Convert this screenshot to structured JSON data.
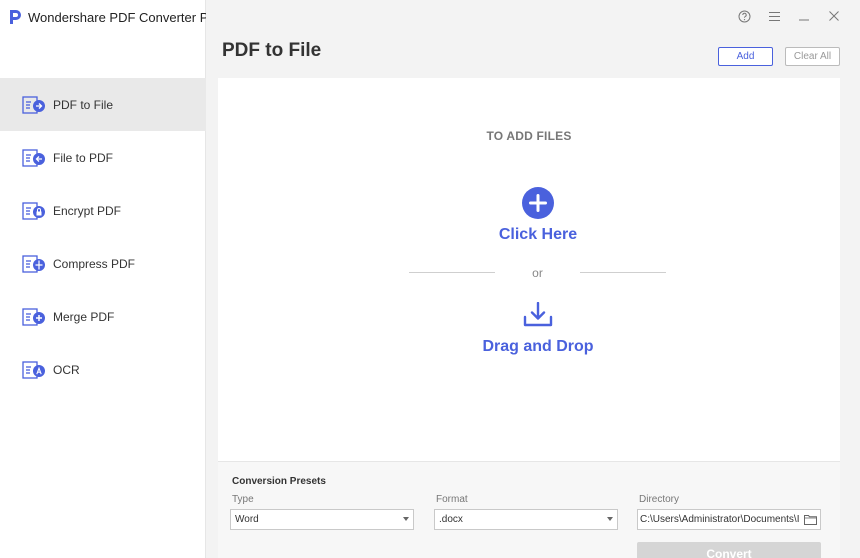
{
  "app": {
    "name": "Wondershare PDF Converter Pro ."
  },
  "sidebar": {
    "items": [
      {
        "label": "PDF to File",
        "icon": "pdf-to-file-icon",
        "active": true
      },
      {
        "label": "File to PDF",
        "icon": "file-to-pdf-icon",
        "active": false
      },
      {
        "label": "Encrypt PDF",
        "icon": "encrypt-pdf-icon",
        "active": false
      },
      {
        "label": "Compress PDF",
        "icon": "compress-pdf-icon",
        "active": false
      },
      {
        "label": "Merge PDF",
        "icon": "merge-pdf-icon",
        "active": false
      },
      {
        "label": "OCR",
        "icon": "ocr-icon",
        "active": false
      }
    ]
  },
  "header": {
    "title": "PDF to File",
    "add_label": "Add",
    "clear_label": "Clear All"
  },
  "drop": {
    "prompt": "TO ADD FILES",
    "click_here": "Click Here",
    "or": "or",
    "drag_drop": "Drag and Drop"
  },
  "presets": {
    "title": "Conversion Presets",
    "type_label": "Type",
    "type_value": "Word",
    "format_label": "Format",
    "format_value": ".docx",
    "directory_label": "Directory",
    "directory_value": "C:\\Users\\Administrator\\Documents\\I",
    "convert_label": "Convert"
  },
  "colors": {
    "accent": "#4a61dd",
    "active_bg": "#e9e9e9",
    "background": "#f3f3f3"
  }
}
